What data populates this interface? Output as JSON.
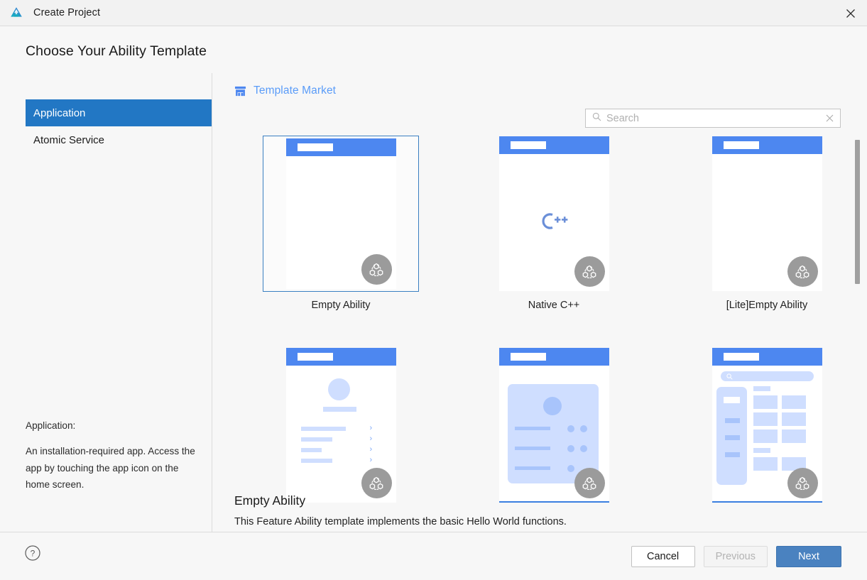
{
  "window": {
    "title": "Create Project",
    "app_icon": "deveco-logo-icon",
    "close_icon": "close-icon"
  },
  "page": {
    "heading": "Choose Your Ability Template"
  },
  "sidebar": {
    "items": [
      {
        "label": "Application",
        "selected": true
      },
      {
        "label": "Atomic Service",
        "selected": false
      }
    ],
    "description": {
      "heading": "Application:",
      "body": "An installation-required app. Access the app by touching the app icon on the home screen."
    }
  },
  "toolbar": {
    "template_market_label": "Template Market",
    "template_market_icon": "store-icon",
    "search": {
      "icon": "search-icon",
      "placeholder": "Search",
      "value": "",
      "clear_icon": "clear-x-icon"
    }
  },
  "templates": [
    {
      "label": "Empty Ability",
      "selected": true,
      "preview": "blank",
      "badge_icon": "harmony-distributed-icon"
    },
    {
      "label": "Native C++",
      "selected": false,
      "preview": "cpp",
      "glyph": "C++",
      "badge_icon": "harmony-distributed-icon"
    },
    {
      "label": "[Lite]Empty Ability",
      "selected": false,
      "preview": "blank",
      "badge_icon": "harmony-distributed-icon"
    },
    {
      "label": "",
      "selected": false,
      "preview": "profile-list",
      "badge_icon": "harmony-distributed-icon"
    },
    {
      "label": "",
      "selected": false,
      "preview": "card-list",
      "badge_icon": "harmony-distributed-icon"
    },
    {
      "label": "",
      "selected": false,
      "preview": "category-grid",
      "badge_icon": "harmony-distributed-icon"
    }
  ],
  "detail": {
    "title": "Empty Ability",
    "description": "This Feature Ability template implements the basic Hello World functions."
  },
  "footer": {
    "help_icon": "help-circle-icon",
    "cancel_label": "Cancel",
    "previous_label": "Previous",
    "next_label": "Next",
    "previous_disabled": true
  },
  "colors": {
    "accent": "#4d87f0",
    "selected_nav": "#2277c4",
    "primary_button": "#4a82c0",
    "link": "#5a9cf8",
    "badge_gray": "#9b9b9b",
    "skeleton": "#cfdeff"
  }
}
